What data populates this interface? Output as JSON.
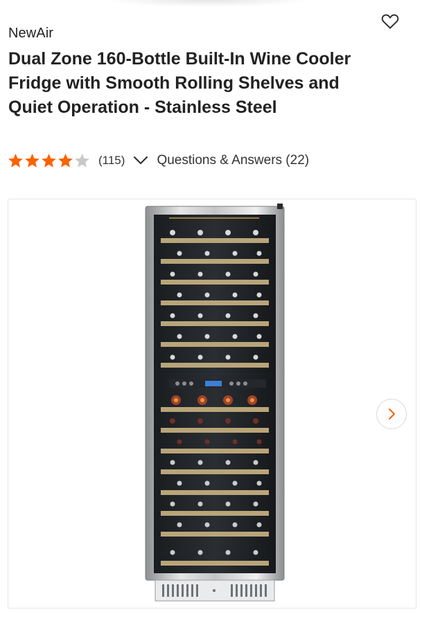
{
  "product": {
    "brand": "NewAir",
    "title": "Dual Zone 160-Bottle Built-In Wine Cooler Fridge with Smooth Rolling Shelves and Quiet Operation - Stainless Steel"
  },
  "rating": {
    "stars": 4,
    "max_stars": 5,
    "review_count": "(115)",
    "qa_label": "Questions & Answers (22)"
  },
  "icons": {
    "favorite": "heart-outline-icon",
    "expand": "chevron-down-icon",
    "next": "chevron-right-icon",
    "star": "star-icon"
  },
  "colors": {
    "star_filled": "#f96302",
    "star_empty": "#c9c9c9",
    "accent": "#f96302",
    "text": "#222222"
  }
}
